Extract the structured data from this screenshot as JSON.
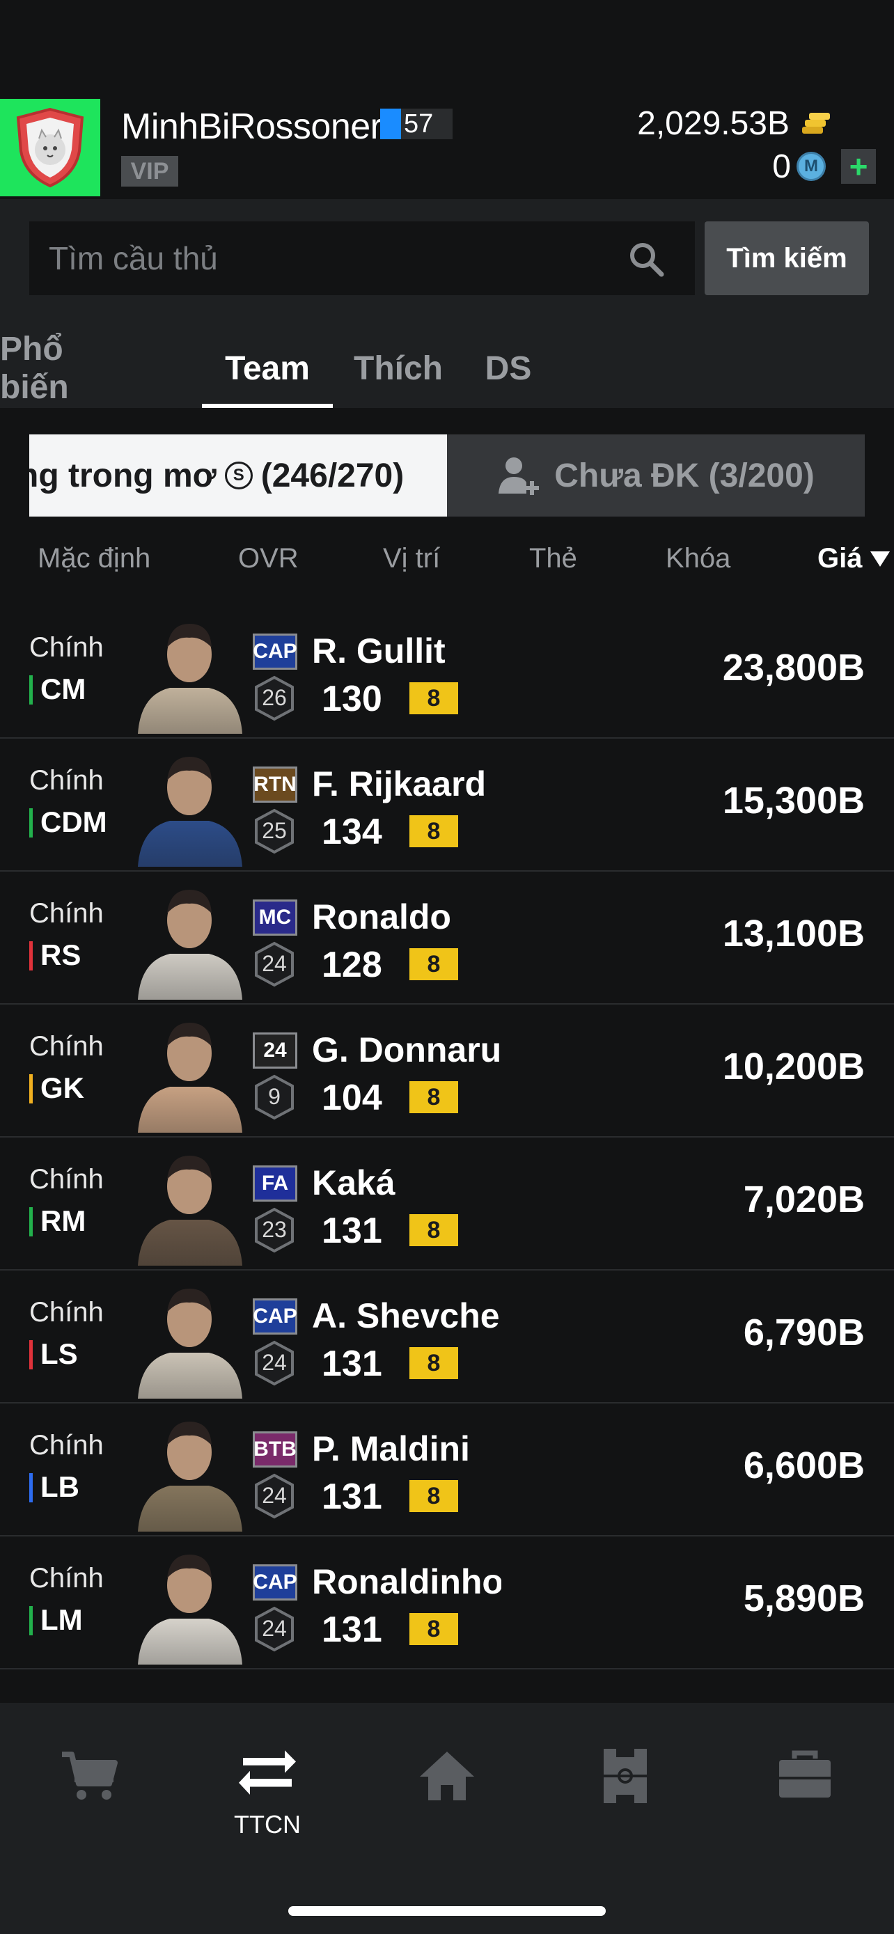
{
  "header": {
    "username": "MinhBiRossoneri",
    "level": "57",
    "vip": "VIP",
    "coins": "2,029.53B",
    "m_coins": "0",
    "m_icon_letter": "M",
    "plus_label": "+"
  },
  "search": {
    "placeholder": "Tìm cầu thủ",
    "button_label": "Tìm kiếm"
  },
  "tabs": [
    {
      "label": "Phổ biến",
      "active": false
    },
    {
      "label": "Team",
      "active": true
    },
    {
      "label": "Thích",
      "active": false
    },
    {
      "label": "DS",
      "active": false
    }
  ],
  "toggle": {
    "left_label": "ng trong mơ",
    "left_icon_letter": "S",
    "left_count": "(246/270)",
    "right_label": "Chưa ĐK (3/200)"
  },
  "sort": {
    "default": "Mặc định",
    "ovr": "OVR",
    "position": "Vị trí",
    "card": "Thẻ",
    "lock": "Khóa",
    "price": "Giá"
  },
  "players": [
    {
      "role": "Chính",
      "pos": "CM",
      "pos_color": "#22b14c",
      "season": "CAP",
      "season_bg": "#1f3f9a",
      "grade": "26",
      "name": "R. Gullit",
      "ovr": "130",
      "level": "8",
      "price": "23,800B"
    },
    {
      "role": "Chính",
      "pos": "CDM",
      "pos_color": "#22b14c",
      "season": "RTN",
      "season_bg": "#6b4a1f",
      "grade": "25",
      "name": "F. Rijkaard",
      "ovr": "134",
      "level": "8",
      "price": "15,300B"
    },
    {
      "role": "Chính",
      "pos": "RS",
      "pos_color": "#e0323a",
      "season": "MC",
      "season_bg": "#2a2a8a",
      "grade": "24",
      "name": "Ronaldo",
      "ovr": "128",
      "level": "8",
      "price": "13,100B"
    },
    {
      "role": "Chính",
      "pos": "GK",
      "pos_color": "#f0b020",
      "season": "24",
      "season_bg": "#222",
      "grade": "9",
      "name": "G. Donnarumma",
      "ovr": "104",
      "level": "8",
      "price": "10,200B"
    },
    {
      "role": "Chính",
      "pos": "RM",
      "pos_color": "#22b14c",
      "season": "FA",
      "season_bg": "#1f2f9a",
      "grade": "23",
      "name": "Kaká",
      "ovr": "131",
      "level": "8",
      "price": "7,020B"
    },
    {
      "role": "Chính",
      "pos": "LS",
      "pos_color": "#e0323a",
      "season": "CAP",
      "season_bg": "#1f3f9a",
      "grade": "24",
      "name": "A. Shevchenko",
      "ovr": "131",
      "level": "8",
      "price": "6,790B"
    },
    {
      "role": "Chính",
      "pos": "LB",
      "pos_color": "#2d6cf0",
      "season": "BTB",
      "season_bg": "#7a2a6a",
      "grade": "24",
      "name": "P. Maldini",
      "ovr": "131",
      "level": "8",
      "price": "6,600B"
    },
    {
      "role": "Chính",
      "pos": "LM",
      "pos_color": "#22b14c",
      "season": "CAP",
      "season_bg": "#1f3f9a",
      "grade": "24",
      "name": "Ronaldinho",
      "ovr": "131",
      "level": "8",
      "price": "5,890B"
    }
  ],
  "bottom_nav": [
    {
      "icon": "cart-icon",
      "label": ""
    },
    {
      "icon": "transfer-icon",
      "label": "TTCN"
    },
    {
      "icon": "home-icon",
      "label": ""
    },
    {
      "icon": "formation-icon",
      "label": ""
    },
    {
      "icon": "briefcase-icon",
      "label": ""
    }
  ],
  "colors": {
    "background": "#121314",
    "panel": "#1e2022",
    "avatar_bg": "#1ee45c",
    "level_chip": "#f0c418",
    "level_bar": "#1a8cff"
  }
}
